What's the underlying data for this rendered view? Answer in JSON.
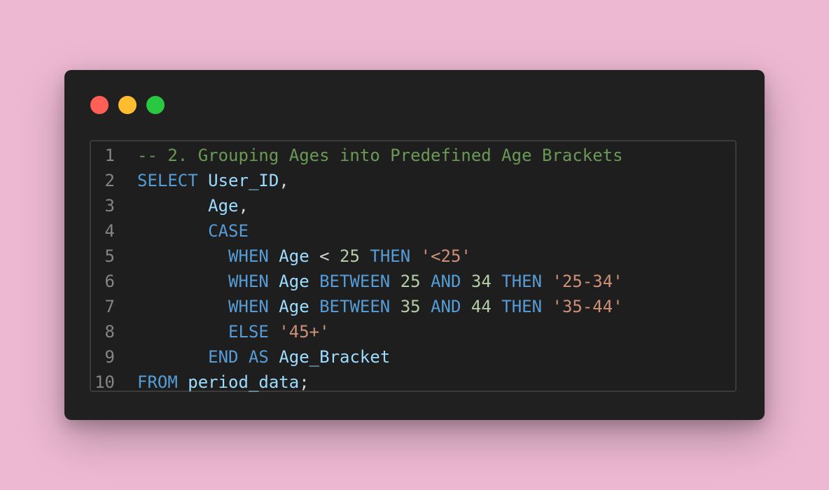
{
  "window": {
    "controls": [
      {
        "name": "close",
        "color": "#ff5f57"
      },
      {
        "name": "minimize",
        "color": "#febc2e"
      },
      {
        "name": "zoom",
        "color": "#28c840"
      }
    ]
  },
  "editor": {
    "language": "sql",
    "colors": {
      "comment": "#6a9955",
      "keyword": "#569cd6",
      "identifier": "#9cdcfe",
      "number": "#b5cea8",
      "string": "#ce9178"
    },
    "lines": [
      {
        "number": "1",
        "tokens": [
          {
            "type": "comment",
            "text": "-- 2. Grouping Ages into Predefined Age Brackets"
          }
        ]
      },
      {
        "number": "2",
        "tokens": [
          {
            "type": "keyword",
            "text": "SELECT"
          },
          {
            "type": "plain",
            "text": " "
          },
          {
            "type": "ident",
            "text": "User_ID"
          },
          {
            "type": "punct",
            "text": ","
          }
        ]
      },
      {
        "number": "3",
        "tokens": [
          {
            "type": "plain",
            "text": "       "
          },
          {
            "type": "ident",
            "text": "Age"
          },
          {
            "type": "punct",
            "text": ","
          }
        ]
      },
      {
        "number": "4",
        "tokens": [
          {
            "type": "plain",
            "text": "       "
          },
          {
            "type": "keyword",
            "text": "CASE"
          }
        ]
      },
      {
        "number": "5",
        "tokens": [
          {
            "type": "plain",
            "text": "         "
          },
          {
            "type": "keyword",
            "text": "WHEN"
          },
          {
            "type": "plain",
            "text": " "
          },
          {
            "type": "ident",
            "text": "Age"
          },
          {
            "type": "punct",
            "text": " < "
          },
          {
            "type": "number",
            "text": "25"
          },
          {
            "type": "plain",
            "text": " "
          },
          {
            "type": "keyword",
            "text": "THEN"
          },
          {
            "type": "plain",
            "text": " "
          },
          {
            "type": "string",
            "text": "'<25'"
          }
        ]
      },
      {
        "number": "6",
        "tokens": [
          {
            "type": "plain",
            "text": "         "
          },
          {
            "type": "keyword",
            "text": "WHEN"
          },
          {
            "type": "plain",
            "text": " "
          },
          {
            "type": "ident",
            "text": "Age"
          },
          {
            "type": "plain",
            "text": " "
          },
          {
            "type": "keyword",
            "text": "BETWEEN"
          },
          {
            "type": "plain",
            "text": " "
          },
          {
            "type": "number",
            "text": "25"
          },
          {
            "type": "plain",
            "text": " "
          },
          {
            "type": "keyword",
            "text": "AND"
          },
          {
            "type": "plain",
            "text": " "
          },
          {
            "type": "number",
            "text": "34"
          },
          {
            "type": "plain",
            "text": " "
          },
          {
            "type": "keyword",
            "text": "THEN"
          },
          {
            "type": "plain",
            "text": " "
          },
          {
            "type": "string",
            "text": "'25-34'"
          }
        ]
      },
      {
        "number": "7",
        "tokens": [
          {
            "type": "plain",
            "text": "         "
          },
          {
            "type": "keyword",
            "text": "WHEN"
          },
          {
            "type": "plain",
            "text": " "
          },
          {
            "type": "ident",
            "text": "Age"
          },
          {
            "type": "plain",
            "text": " "
          },
          {
            "type": "keyword",
            "text": "BETWEEN"
          },
          {
            "type": "plain",
            "text": " "
          },
          {
            "type": "number",
            "text": "35"
          },
          {
            "type": "plain",
            "text": " "
          },
          {
            "type": "keyword",
            "text": "AND"
          },
          {
            "type": "plain",
            "text": " "
          },
          {
            "type": "number",
            "text": "44"
          },
          {
            "type": "plain",
            "text": " "
          },
          {
            "type": "keyword",
            "text": "THEN"
          },
          {
            "type": "plain",
            "text": " "
          },
          {
            "type": "string",
            "text": "'35-44'"
          }
        ]
      },
      {
        "number": "8",
        "tokens": [
          {
            "type": "plain",
            "text": "         "
          },
          {
            "type": "keyword",
            "text": "ELSE"
          },
          {
            "type": "plain",
            "text": " "
          },
          {
            "type": "string",
            "text": "'45+'"
          }
        ]
      },
      {
        "number": "9",
        "tokens": [
          {
            "type": "plain",
            "text": "       "
          },
          {
            "type": "keyword",
            "text": "END"
          },
          {
            "type": "plain",
            "text": " "
          },
          {
            "type": "keyword",
            "text": "AS"
          },
          {
            "type": "plain",
            "text": " "
          },
          {
            "type": "ident",
            "text": "Age_Bracket"
          }
        ]
      },
      {
        "number": "10",
        "tokens": [
          {
            "type": "keyword",
            "text": "FROM"
          },
          {
            "type": "plain",
            "text": " "
          },
          {
            "type": "ident",
            "text": "period_data"
          },
          {
            "type": "punct",
            "text": ";"
          }
        ]
      }
    ]
  }
}
